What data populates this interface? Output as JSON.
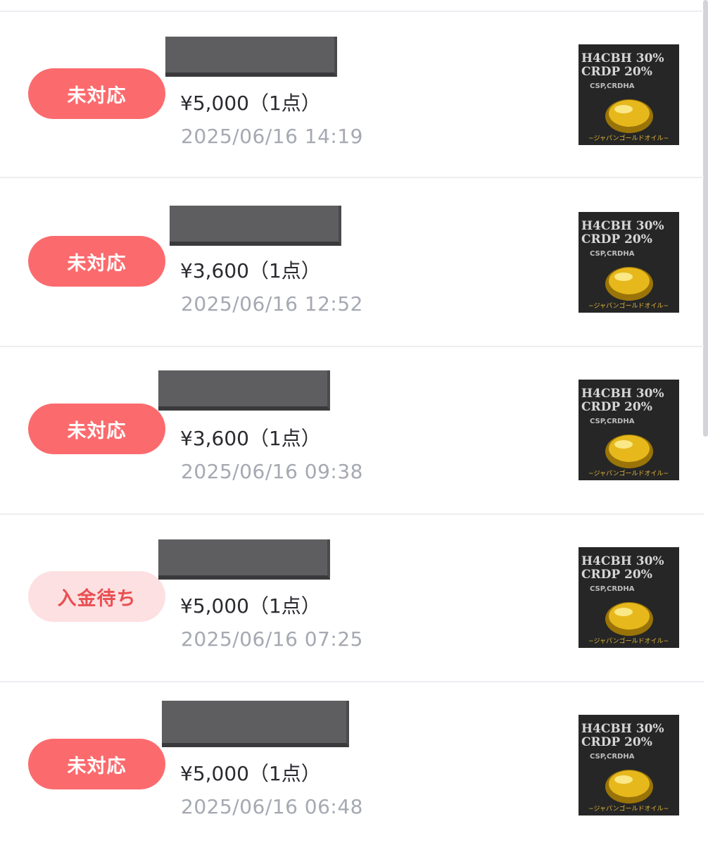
{
  "orders": [
    {
      "status": "未対応",
      "status_type": "unhandled",
      "price": "¥5,000（1点）",
      "datetime": "2025/06/16 14:19"
    },
    {
      "status": "未対応",
      "status_type": "unhandled",
      "price": "¥3,600（1点）",
      "datetime": "2025/06/16 12:52"
    },
    {
      "status": "未対応",
      "status_type": "unhandled",
      "price": "¥3,600（1点）",
      "datetime": "2025/06/16 09:38"
    },
    {
      "status": "入金待ち",
      "status_type": "waiting",
      "price": "¥5,000（1点）",
      "datetime": "2025/06/16 07:25"
    },
    {
      "status": "未対応",
      "status_type": "unhandled",
      "price": "¥5,000（1点）",
      "datetime": "2025/06/16 06:48"
    }
  ],
  "thumbnail": {
    "line1": "H4CBH 30%",
    "line2": "CRDP 20%",
    "line3": "CSP,CRDHA",
    "footer": "~ジャパンゴールドオイル~"
  },
  "colors": {
    "unhandled_bg": "#fb6b6e",
    "waiting_bg": "#fde0e1",
    "waiting_text": "#ea4f52",
    "date_text": "#a6a8b2",
    "redaction": "#5e5e60"
  }
}
